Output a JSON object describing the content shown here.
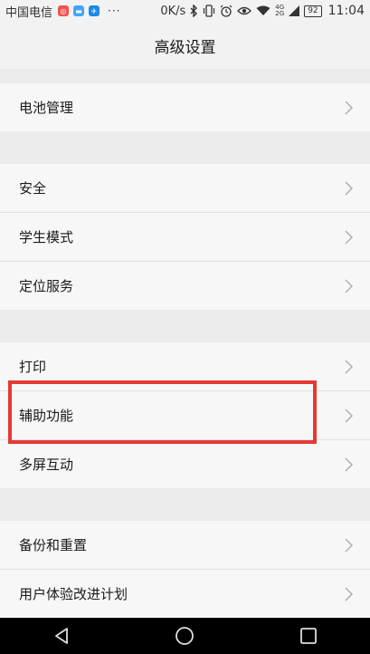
{
  "status_bar": {
    "carrier": "中国电信",
    "apps": [
      {
        "name": "app-icon-red",
        "color": "#ef5350"
      },
      {
        "name": "app-icon-blue-chat",
        "color": "#42a5f5"
      },
      {
        "name": "app-icon-blue-runner",
        "color": "#1e88e5"
      }
    ],
    "more": "···",
    "net_speed": "0K/s",
    "network_badge_top": "4G",
    "network_badge_bottom": "2G",
    "battery": "92",
    "time": "11:04"
  },
  "header": {
    "title": "高级设置"
  },
  "settings": {
    "battery_mgmt": "电池管理",
    "security": "安全",
    "student_mode": "学生模式",
    "location": "定位服务",
    "print": "打印",
    "accessibility": "辅助功能",
    "multi_screen": "多屏互动",
    "backup_reset": "备份和重置",
    "user_experience": "用户体验改进计划"
  },
  "highlight_color": "#e53935"
}
